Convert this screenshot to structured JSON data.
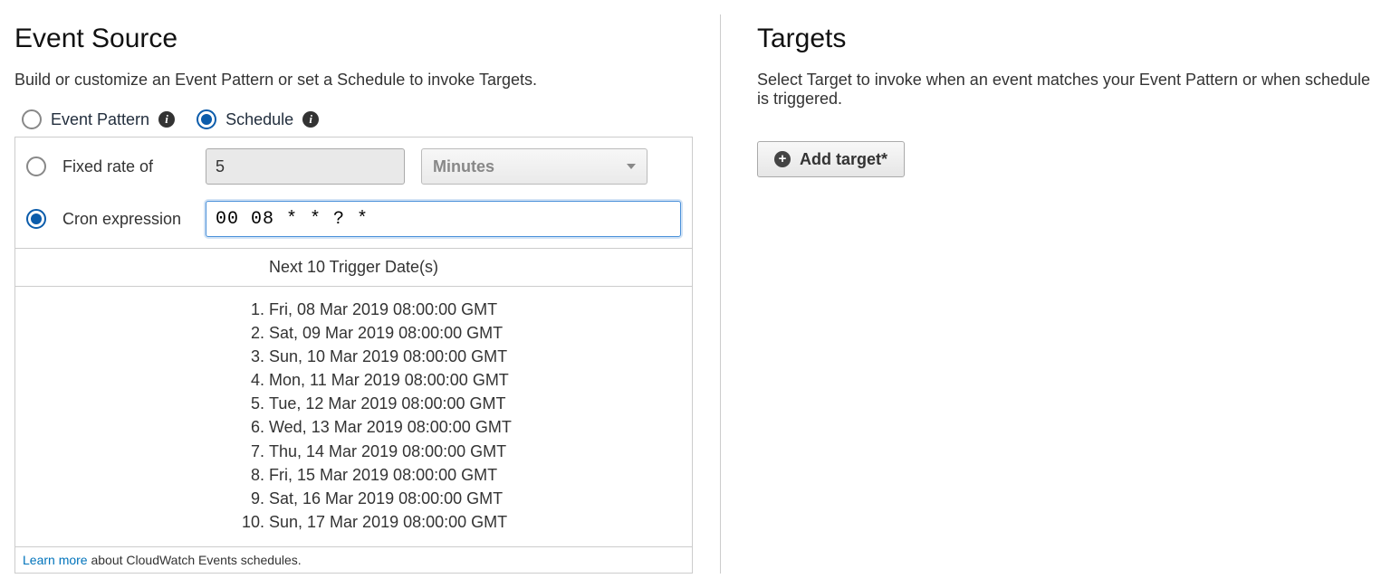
{
  "eventSource": {
    "heading": "Event Source",
    "description": "Build or customize an Event Pattern or set a Schedule to invoke Targets.",
    "patternType": {
      "pattern_label": "Event Pattern",
      "schedule_label": "Schedule",
      "selected": "schedule"
    },
    "schedule": {
      "fixed_rate_label": "Fixed rate of",
      "fixed_rate_value": "5",
      "fixed_rate_unit": "Minutes",
      "cron_label": "Cron expression",
      "cron_value": "00 08 * * ? *",
      "schedule_mode": "cron"
    },
    "trigger_header": "Next 10 Trigger Date(s)",
    "trigger_dates": [
      "Fri, 08 Mar 2019 08:00:00 GMT",
      "Sat, 09 Mar 2019 08:00:00 GMT",
      "Sun, 10 Mar 2019 08:00:00 GMT",
      "Mon, 11 Mar 2019 08:00:00 GMT",
      "Tue, 12 Mar 2019 08:00:00 GMT",
      "Wed, 13 Mar 2019 08:00:00 GMT",
      "Thu, 14 Mar 2019 08:00:00 GMT",
      "Fri, 15 Mar 2019 08:00:00 GMT",
      "Sat, 16 Mar 2019 08:00:00 GMT",
      "Sun, 17 Mar 2019 08:00:00 GMT"
    ],
    "footer_link": "Learn more",
    "footer_text": "about CloudWatch Events schedules."
  },
  "targets": {
    "heading": "Targets",
    "description": "Select Target to invoke when an event matches your Event Pattern or when schedule is triggered.",
    "add_button_label": "Add target*"
  }
}
